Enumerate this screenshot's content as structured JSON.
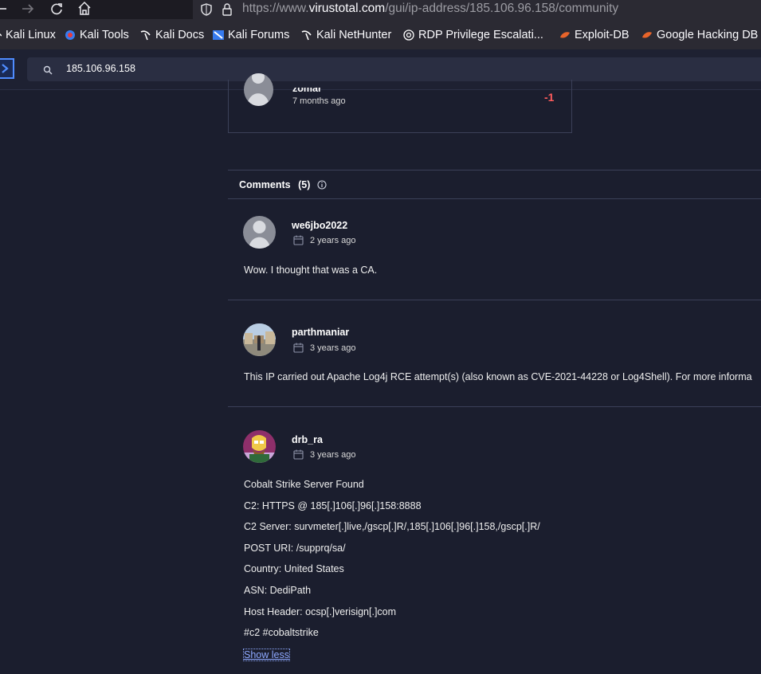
{
  "browser": {
    "url_prefix": "https://www.",
    "url_host": "virustotal.com",
    "url_path": "/gui/ip-address/185.106.96.158/community",
    "bookmarks": [
      {
        "label": "Kali Linux",
        "icon": "kali-dragon-icon"
      },
      {
        "label": "Kali Tools",
        "icon": "kali-tools-icon"
      },
      {
        "label": "Kali Docs",
        "icon": "kali-dragon-icon"
      },
      {
        "label": "Kali Forums",
        "icon": "kali-forums-icon"
      },
      {
        "label": "Kali NetHunter",
        "icon": "kali-dragon-icon"
      },
      {
        "label": "RDP Privilege Escalati...",
        "icon": "globe-icon"
      },
      {
        "label": "Exploit-DB",
        "icon": "exploit-db-icon"
      },
      {
        "label": "Google Hacking DB",
        "icon": "exploit-db-icon"
      }
    ]
  },
  "vt": {
    "search_value": "185.106.96.158"
  },
  "vote": {
    "user": "zomar",
    "time": "7 months ago",
    "score": "-1",
    "score_color": "#ff5c5c"
  },
  "comments": {
    "title": "Comments",
    "count": "(5)",
    "items": [
      {
        "user": "we6jbo2022",
        "date": "2 years ago",
        "avatar": "default-avatar",
        "lines": [
          "Wow. I thought that was a CA."
        ]
      },
      {
        "user": "parthmaniar",
        "date": "3 years ago",
        "avatar": "photo-avatar",
        "lines": [
          "This IP carried out Apache Log4j RCE attempt(s) (also known as CVE-2021-44228 or Log4Shell). For more informa"
        ]
      },
      {
        "user": "drb_ra",
        "date": "3 years ago",
        "avatar": "cartoon-avatar",
        "lines": [
          "Cobalt Strike Server Found",
          "C2: HTTPS @ 185[.]106[.]96[.]158:8888",
          "C2 Server: survmeter[.]live,/gscp[.]R/,185[.]106[.]96[.]158,/gscp[.]R/",
          "POST URI: /supprq/sa/",
          "Country: United States",
          "ASN: DediPath",
          "Host Header: ocsp[.]verisign[.]com",
          "#c2 #cobaltstrike"
        ]
      }
    ],
    "show_less": "Show less"
  }
}
